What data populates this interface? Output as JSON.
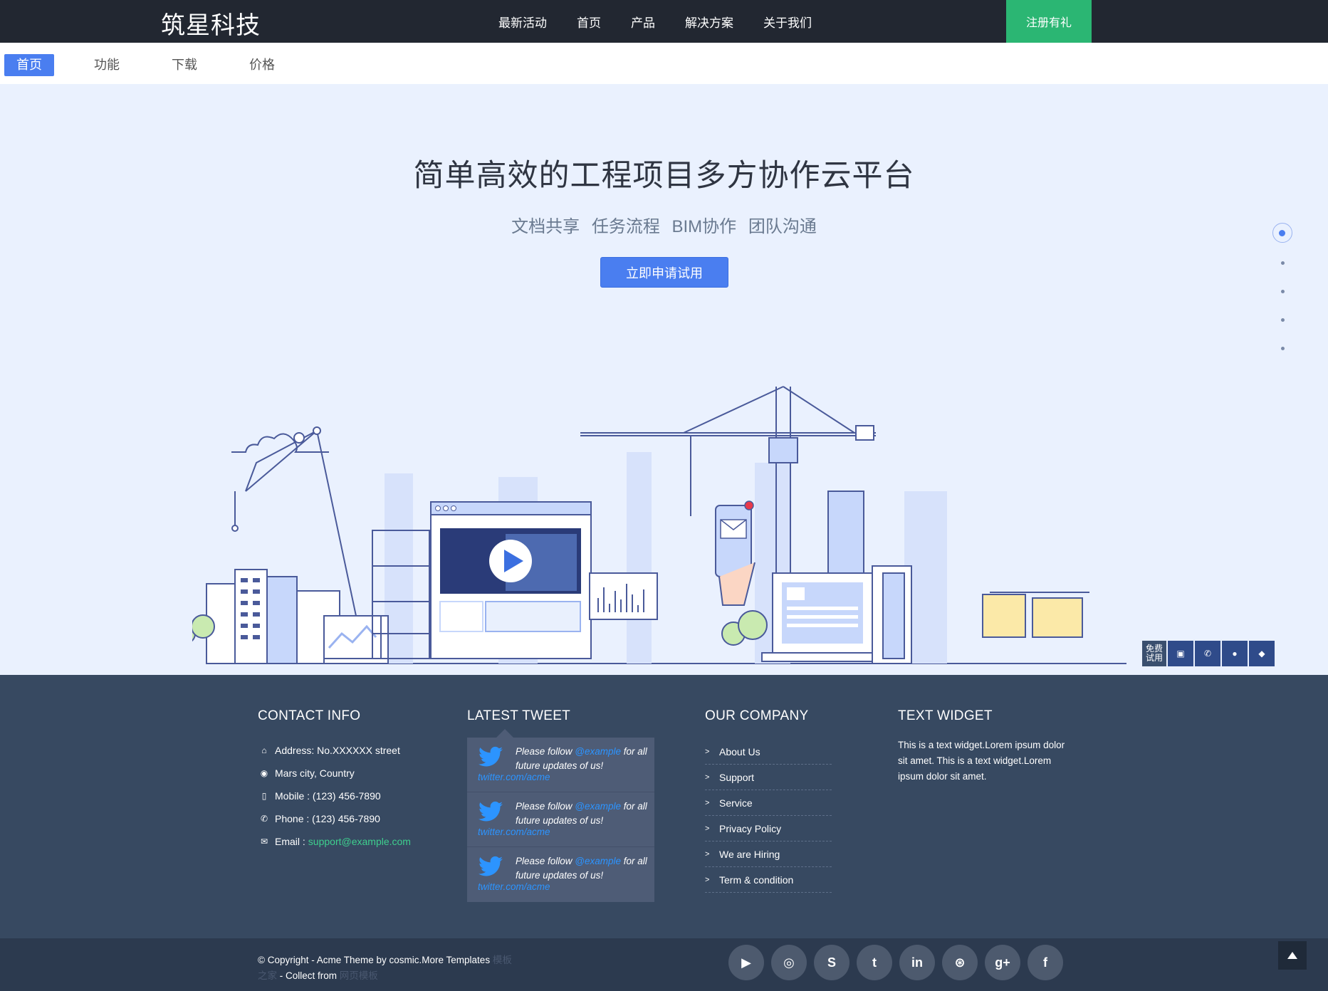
{
  "header": {
    "logo": "筑星科技",
    "nav": [
      "最新活动",
      "首页",
      "产品",
      "解决方案",
      "关于我们"
    ],
    "signup": "注册有礼"
  },
  "subnav": [
    "首页",
    "功能",
    "下载",
    "价格"
  ],
  "hero": {
    "title": "简单高效的工程项目多方协作云平台",
    "subtitle": "文档共享  任务流程  BIM协作  团队沟通",
    "cta": "立即申请试用",
    "slide_count": 5,
    "active_slide": 0
  },
  "floating": {
    "trial_label": "免费试用"
  },
  "footer": {
    "contact": {
      "heading": "CONTACT INFO",
      "address": "Address: No.XXXXXX street",
      "city": "Mars city, Country",
      "mobile": "Mobile : (123) 456-7890",
      "phone": "Phone : (123) 456-7890",
      "email_label": "Email :",
      "email": "support@example.com"
    },
    "tweets": {
      "heading": "LATEST TWEET",
      "items": [
        {
          "pre": "Please follow ",
          "handle": "@example",
          "post": " for all future updates of us!",
          "link": "twitter.com/acme"
        },
        {
          "pre": "Please follow ",
          "handle": "@example",
          "post": " for all future updates of us!",
          "link": "twitter.com/acme"
        },
        {
          "pre": "Please follow ",
          "handle": "@example",
          "post": " for all future updates of us!",
          "link": "twitter.com/acme"
        }
      ]
    },
    "company": {
      "heading": "OUR COMPANY",
      "links": [
        "About Us",
        "Support",
        "Service",
        "Privacy Policy",
        "We are Hiring",
        "Term & condition"
      ]
    },
    "text_widget": {
      "heading": "TEXT WIDGET",
      "body": "This is a text widget.Lorem ipsum dolor sit amet. This is a text widget.Lorem ipsum dolor sit amet."
    }
  },
  "bottom": {
    "copyright": "© Copyright - Acme Theme by cosmic.More Templates",
    "faint1": "模板之家",
    "collect": " - Collect from ",
    "faint2": "网页模板",
    "social": [
      "youtube-icon",
      "github-icon",
      "skype-icon",
      "twitter-icon",
      "linkedin-icon",
      "dribbble-icon",
      "google-plus-icon",
      "facebook-icon"
    ]
  }
}
